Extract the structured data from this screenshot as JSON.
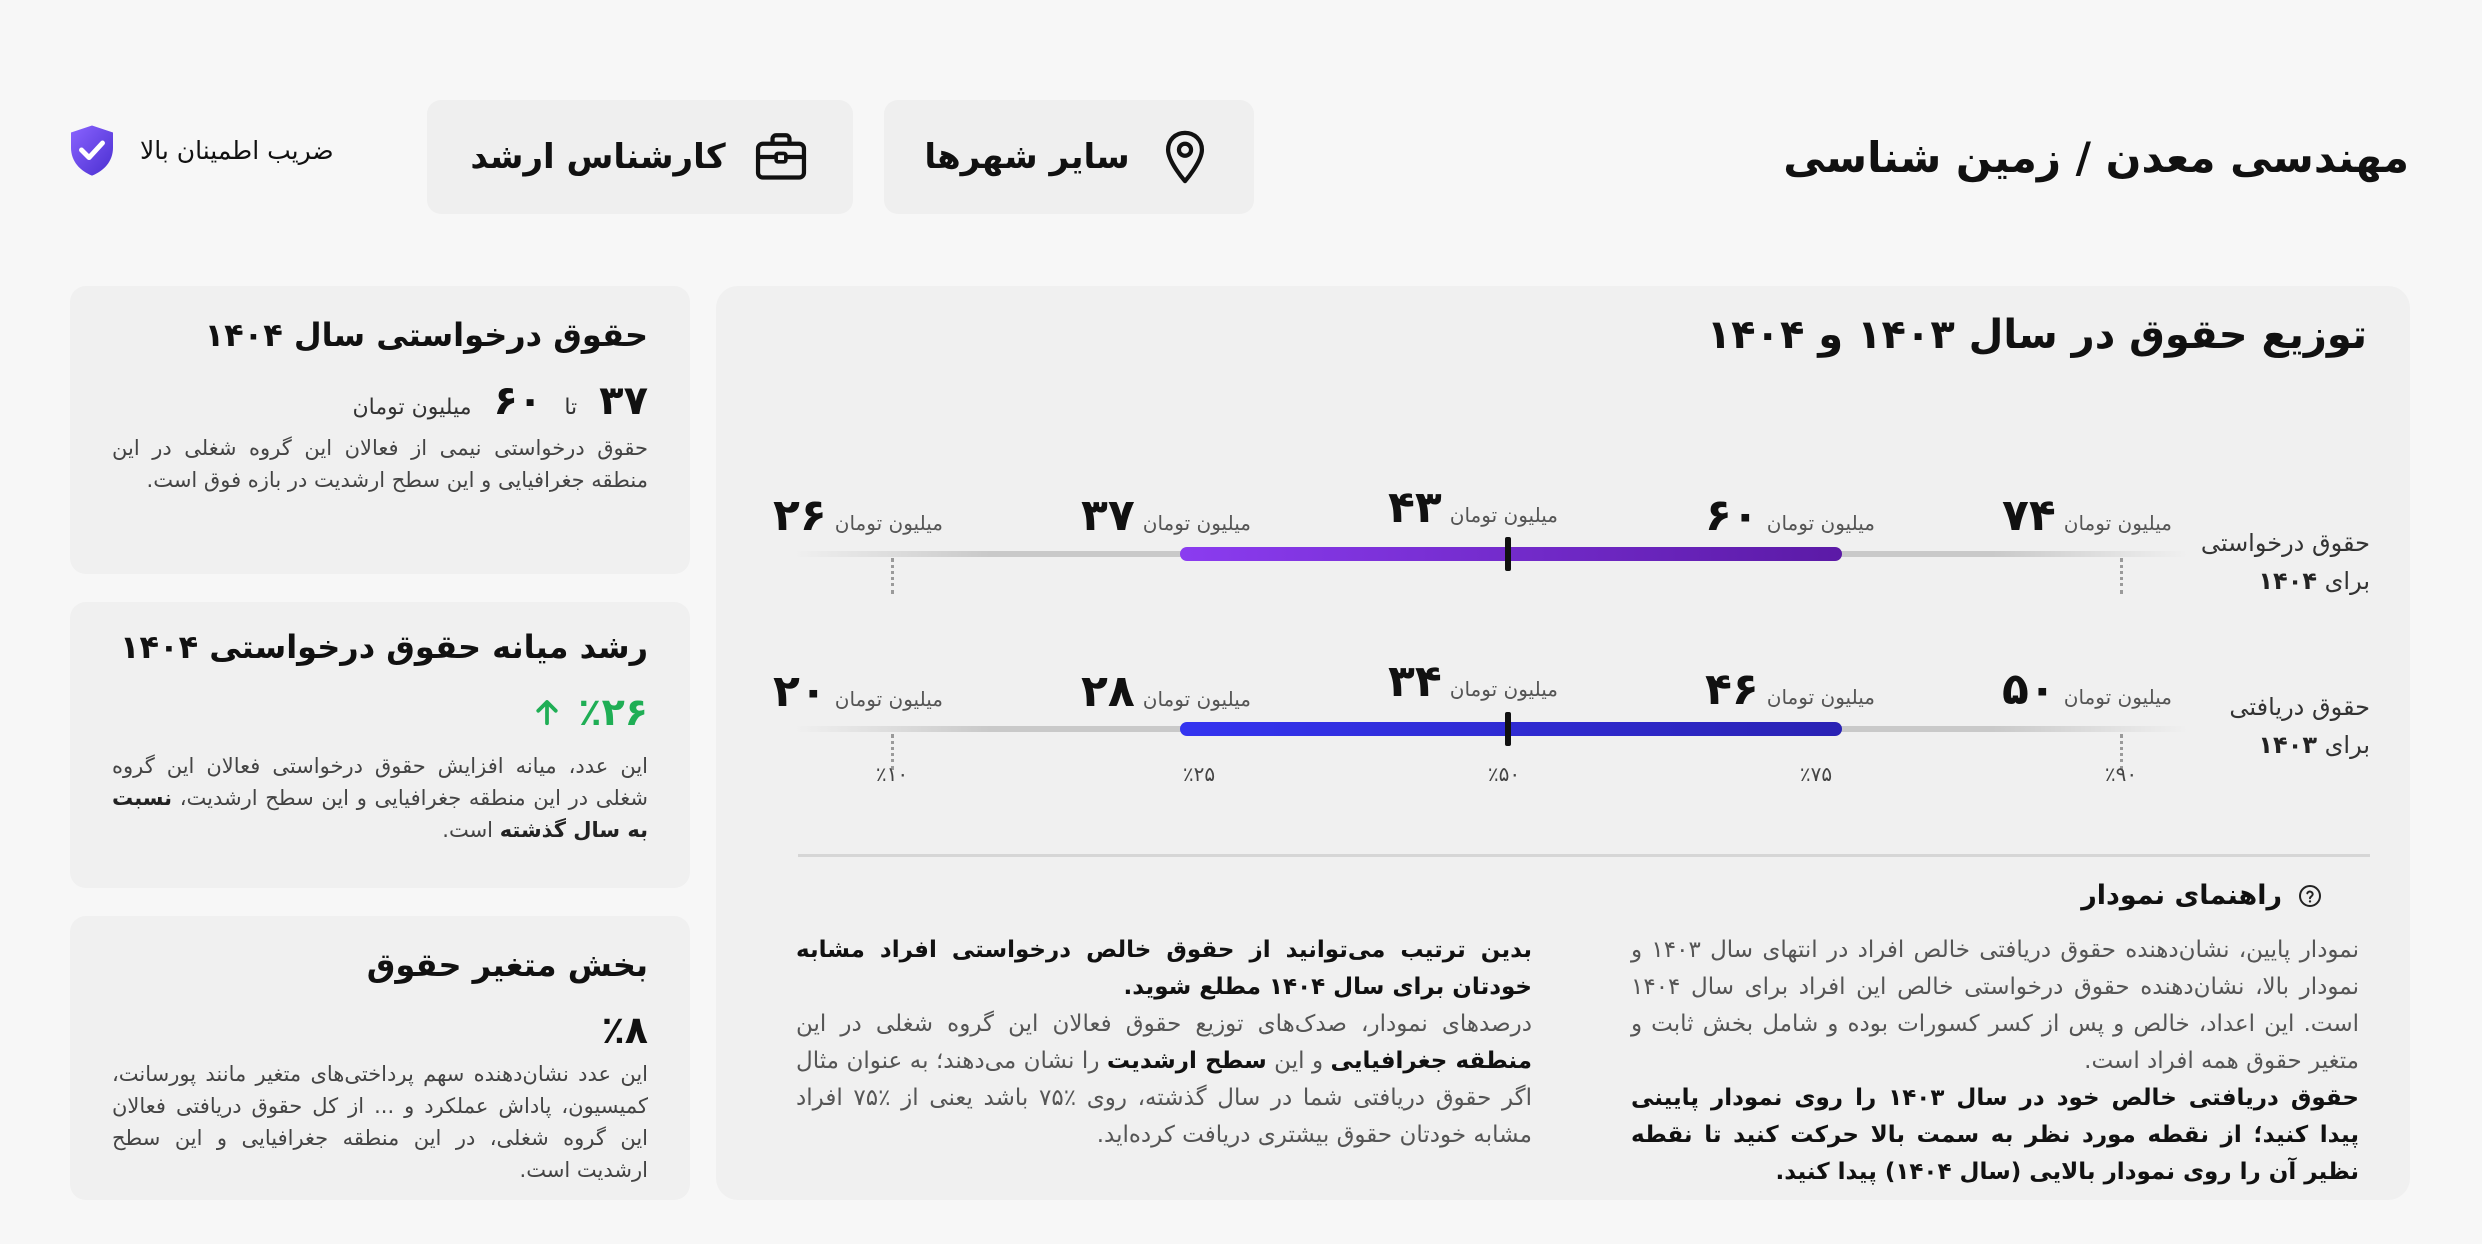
{
  "header": {
    "title": "مهندسی معدن / زمین شناسی",
    "city_chip": "سایر شهرها",
    "level_chip": "کارشناس ارشد",
    "trust_label": "ضریب اطمینان بالا"
  },
  "chart_panel": {
    "title": "توزیع حقوق در سال ۱۴۰۳ و ۱۴۰۴",
    "unit": "میلیون تومان",
    "row_requested": {
      "label_line1": "حقوق درخواستی",
      "label_line2_prefix": "برای",
      "label_line2_year": "۱۴۰۴",
      "values": {
        "p10": "۲۶",
        "p25": "۳۷",
        "p50": "۴۳",
        "p75": "۶۰",
        "p90": "۷۴"
      }
    },
    "row_received": {
      "label_line1": "حقوق دریافتی",
      "label_line2_prefix": "برای",
      "label_line2_year": "۱۴۰۳",
      "values": {
        "p10": "۲۰",
        "p25": "۲۸",
        "p50": "۳۴",
        "p75": "۴۶",
        "p90": "۵۰"
      }
    },
    "percentiles": {
      "p10": "٪۱۰",
      "p25": "٪۲۵",
      "p50": "٪۵۰",
      "p75": "٪۷۵",
      "p90": "٪۹۰"
    },
    "guide": {
      "title": "راهنمای نمودار",
      "col_right_p1": "نمودار پایین، نشان‌دهنده حقوق دریافتی خالص افراد در انتهای سال ۱۴۰۳ و نمودار بالا، نشان‌دهنده حقوق درخواستی خالص این افراد برای سال ۱۴۰۴ است. این اعداد، خالص و پس از کسر کسورات بوده و شامل بخش ثابت و متغیر حقوق همه افراد است.",
      "col_right_p2": "حقوق دریافتی خالص خود در سال ۱۴۰۳ را روی نمودار پایینی پیدا کنید؛ از نقطه مورد نظر به سمت بالا حرکت کنید تا نقطه نظیر آن را روی نمودار بالایی (سال ۱۴۰۴) پیدا کنید.",
      "col_left_p1": "بدین ترتیب می‌توانید از حقوق خالص درخواستی افراد مشابه خودتان برای سال ۱۴۰۴ مطلع شوید.",
      "col_left_p2a": "درصدهای نمودار، صدک‌های توزیع حقوق فعالان این گروه شغلی در این ",
      "col_left_p2b": "منطقه جغرافیایی",
      "col_left_p2c": " و این ",
      "col_left_p2d": "سطح ارشدیت",
      "col_left_p2e": " را نشان می‌دهند؛ به عنوان مثال اگر حقوق دریافتی شما در سال گذشته، روی ٪۷۵ باشد یعنی از ٪۷۵ افراد مشابه خودتان حقوق بیشتری دریافت کرده‌اید."
    }
  },
  "cards": {
    "requested_salary": {
      "title": "حقوق درخواستی سال ۱۴۰۴",
      "from": "۳۷",
      "to_word": "تا",
      "to": "۶۰",
      "unit": "میلیون تومان",
      "text": "حقوق درخواستی نیمی از فعالان این گروه شغلی در این منطقه جغرافیایی و این سطح ارشدیت در بازه فوق است."
    },
    "median_growth": {
      "title": "رشد میانه حقوق درخواستی ۱۴۰۴",
      "value": "٪۲۶",
      "text_a": "این عدد، میانه افزایش حقوق درخواستی فعالان این گروه شغلی در این منطقه جغرافیایی و این سطح ارشدیت، ",
      "text_b": "نسبت به سال گذشته",
      "text_c": " است."
    },
    "variable_pay": {
      "title": "بخش متغیر حقوق",
      "value": "٪۸",
      "text": "این عدد نشان‌دهنده سهم پرداختی‌های متغیر مانند پورسانت، کمیسیون، پاداش عملکرد و ... از کل حقوق دریافتی فعالان این گروه شغلی، در این منطقه جغرافیایی و این سطح ارشدیت است."
    }
  },
  "colors": {
    "requested_bar": "#7a2fe0",
    "received_bar": "#3030e0",
    "growth_green": "#1fae55",
    "shield": "#6d4cf0"
  },
  "icons": {
    "city": "location-pin-icon",
    "level": "briefcase-icon",
    "trust": "shield-check-icon",
    "guide": "help-circle-icon",
    "growth": "arrow-up-icon"
  }
}
